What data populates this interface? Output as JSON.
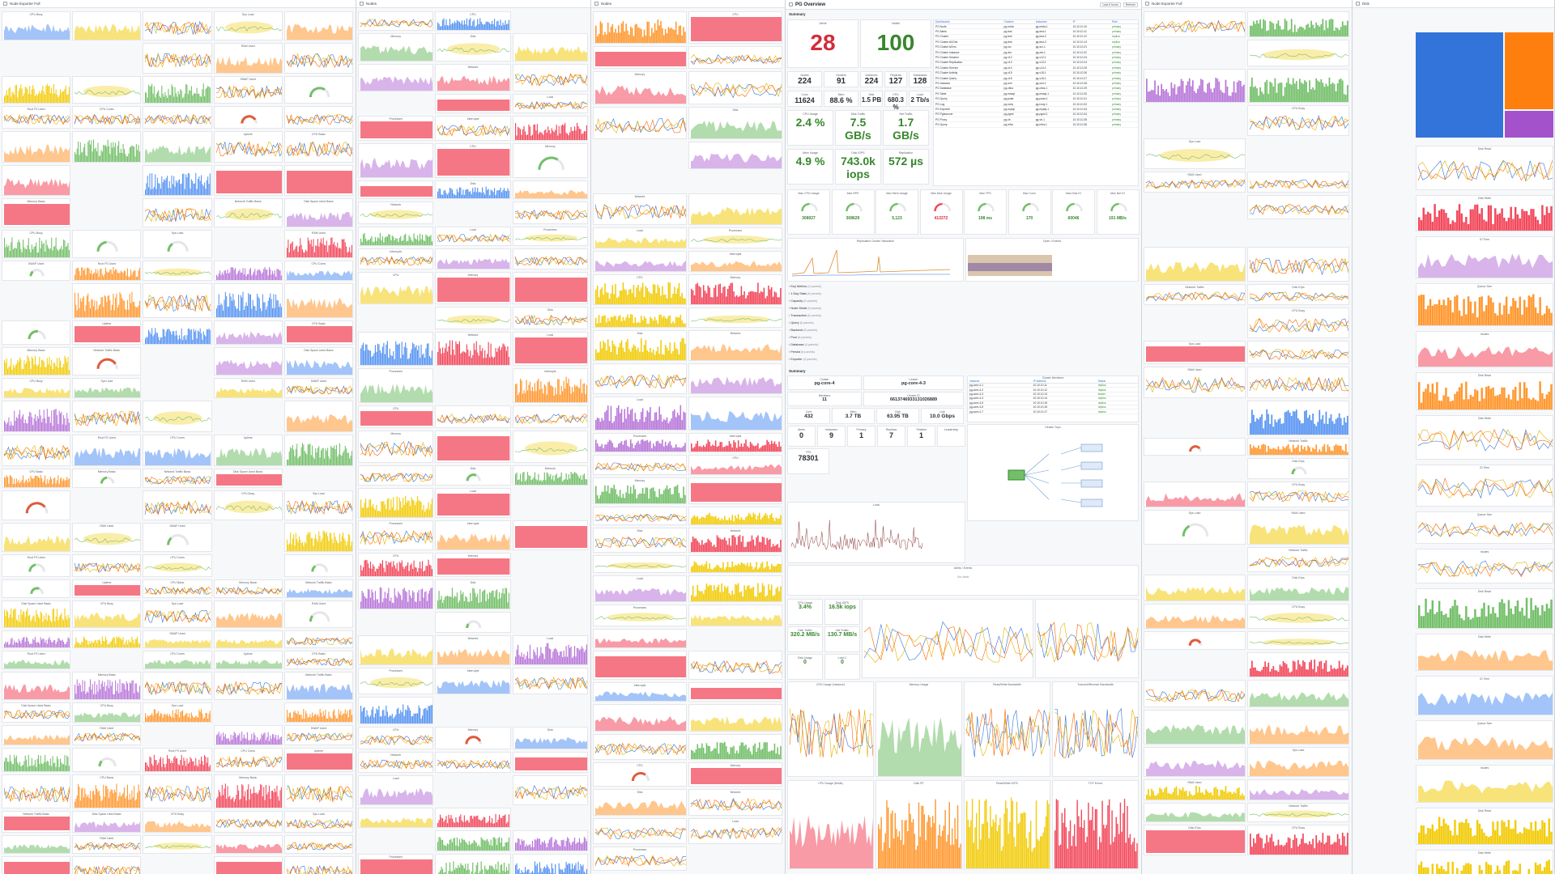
{
  "windows": [
    {
      "id": "w1",
      "title": "Node Exporter Full"
    },
    {
      "id": "w2",
      "title": "Nodes"
    },
    {
      "id": "w3",
      "title": "PG Overview"
    },
    {
      "id": "w4",
      "title": "Node Exporter Full"
    },
    {
      "id": "w5",
      "title": "Disk"
    }
  ],
  "pg": {
    "title": "PG Overview",
    "toolbar": [
      "Last 6 hours",
      "Refresh"
    ],
    "summary_label": "Summary",
    "stats_big": [
      {
        "label": "Alerts",
        "value": "28",
        "tone": "red"
      },
      {
        "label": "Health",
        "value": "100",
        "tone": "grn"
      }
    ],
    "stats_row1": [
      {
        "label": "Nodes",
        "value": "224"
      },
      {
        "label": "Clusters",
        "value": "91"
      },
      {
        "label": "Instances",
        "value": "224"
      },
      {
        "label": "Replicas",
        "value": "127"
      },
      {
        "label": "Databases",
        "value": "128"
      }
    ],
    "stats_row2": [
      {
        "label": "Conn",
        "value": "11624"
      },
      {
        "label": "Mem",
        "value": "88.6 %"
      },
      {
        "label": "Disk",
        "value": "1.5 PB"
      },
      {
        "label": "CPU",
        "value": "680.3 %"
      },
      {
        "label": "Load",
        "value": "2 Tb/s"
      }
    ],
    "stats_row3": [
      {
        "label": "CPU Usage",
        "value": "2.4 %"
      },
      {
        "label": "Disk Traffic",
        "value": "7.5 GB/s"
      },
      {
        "label": "Net Traffic",
        "value": "1.7 GB/s"
      }
    ],
    "stats_row4": [
      {
        "label": "Mem Usage",
        "value": "4.9 %"
      },
      {
        "label": "Disk IOPS",
        "value": "743.0k iops"
      },
      {
        "label": "Replication",
        "value": "572 µs"
      }
    ],
    "dash_table": {
      "headers": [
        "Dashboards",
        "Clusters",
        "Instances",
        "IP",
        "Role"
      ],
      "rows": [
        [
          "PG Node",
          "pg-meta",
          "pg-meta-1",
          "10.10.10.10",
          "primary"
        ],
        [
          "PG Alerts",
          "pg-test",
          "pg-test-1",
          "10.10.10.11",
          "primary"
        ],
        [
          "PG Cluster",
          "pg-test",
          "pg-test-2",
          "10.10.10.12",
          "replica"
        ],
        [
          "PG Cluster All Dbs",
          "pg-test",
          "pg-test-3",
          "10.10.10.13",
          "replica"
        ],
        [
          "PG Cluster All Ins",
          "pg-src",
          "pg-src-1",
          "10.10.10.21",
          "primary"
        ],
        [
          "PG Cluster Instance",
          "pg-dst",
          "pg-dst-1",
          "10.10.10.22",
          "primary"
        ],
        [
          "PG Cluster Session",
          "pg-v12",
          "pg-v12-1",
          "10.10.10.23",
          "primary"
        ],
        [
          "PG Cluster Replication",
          "pg-v13",
          "pg-v13-1",
          "10.10.10.24",
          "primary"
        ],
        [
          "PG Cluster Service",
          "pg-v14",
          "pg-v14-1",
          "10.10.10.25",
          "primary"
        ],
        [
          "PG Cluster Activity",
          "pg-v15",
          "pg-v15-1",
          "10.10.10.26",
          "primary"
        ],
        [
          "PG Cluster Query",
          "pg-v16",
          "pg-v16-1",
          "10.10.10.27",
          "primary"
        ],
        [
          "PG Instance",
          "pg-orcl",
          "pg-orcl-1",
          "10.10.10.28",
          "primary"
        ],
        [
          "PG Database",
          "pg-citus",
          "pg-citus-1",
          "10.10.10.29",
          "primary"
        ],
        [
          "PG Table",
          "pg-mssql",
          "pg-mssql-1",
          "10.10.10.30",
          "primary"
        ],
        [
          "PG Query",
          "pg-polar",
          "pg-polar-1",
          "10.10.10.31",
          "primary"
        ],
        [
          "PG Log",
          "pg-ivory",
          "pg-ivory-1",
          "10.10.10.32",
          "primary"
        ],
        [
          "PG Exporter",
          "pg-mysql",
          "pg-mysql-1",
          "10.10.10.33",
          "primary"
        ],
        [
          "PG Pgbouncer",
          "pg-pgml",
          "pg-pgml-1",
          "10.10.10.34",
          "primary"
        ],
        [
          "PG Proxy",
          "pg-vb",
          "pg-vb-1",
          "10.10.10.35",
          "primary"
        ],
        [
          "PG Query",
          "pg-infra",
          "pg-infra-1",
          "10.10.10.36",
          "primary"
        ]
      ]
    },
    "mid_row_labels": [
      "Max CPU Usage",
      "Max RPS",
      "Max Mem Usage",
      "Max Disk Usage",
      "Max TPS",
      "Max Conn",
      "Max Disk IO",
      "Max Net IO"
    ],
    "mid_row_values": [
      "308027",
      "308629",
      "5,123",
      "412272",
      "198 ms",
      "170",
      "60046",
      "191 MB/s"
    ],
    "replication_title": "Replication Cluster Saturation",
    "open_events_title": "Open / Events",
    "collapsed": [
      {
        "label": "Key Metrics",
        "n": "(4 panels)"
      },
      {
        "label": "1 Day Stats",
        "n": "(6 panels)"
      },
      {
        "label": "Capacity",
        "n": "(6 panels)"
      },
      {
        "label": "Node Detail",
        "n": "(8 panels)"
      },
      {
        "label": "Transaction",
        "n": "(8 panels)"
      },
      {
        "label": "Query",
        "n": "(6 panels)"
      },
      {
        "label": "Backend",
        "n": "(8 panels)"
      },
      {
        "label": "Pool",
        "n": "(6 panels)"
      },
      {
        "label": "Database",
        "n": "(4 panels)"
      },
      {
        "label": "Persist",
        "n": "(6 panels)"
      },
      {
        "label": "Exporter",
        "n": "(4 panels)"
      }
    ],
    "summary2": "Summary",
    "cluster_stats": [
      {
        "label": "Cluster",
        "value": "pg-core-4"
      },
      {
        "label": "Leader",
        "value": "pg-core-4-3"
      },
      {
        "label": "Members",
        "value": "11"
      },
      {
        "label": "Cluster ID",
        "value": "6613746933131026889"
      }
    ],
    "cap_stats": [
      {
        "label": "Core",
        "value": "432"
      },
      {
        "label": "Mem",
        "value": "3.7 TB"
      },
      {
        "label": "Disk",
        "value": "63.95 TB"
      },
      {
        "label": "Link",
        "value": "10.0 Gbps"
      }
    ],
    "role_stats": [
      {
        "label": "Alerts",
        "value": "0"
      },
      {
        "label": "Instances",
        "value": "9"
      },
      {
        "label": "Primary",
        "value": "1"
      },
      {
        "label": "Replicas",
        "value": "7"
      },
      {
        "label": "Timeline",
        "value": "1"
      },
      {
        "label": "Leadership",
        "value": ""
      }
    ],
    "members_title": "Cluster Members",
    "members_headers": [
      "Instance",
      "IP Address",
      "Status"
    ],
    "members": [
      [
        "pg-core-4-1",
        "10.10.10.11",
        "replica"
      ],
      [
        "pg-core-4-2",
        "10.10.10.12",
        "replica"
      ],
      [
        "pg-core-4-3",
        "10.10.10.13",
        "leader"
      ],
      [
        "pg-core-4-4",
        "10.10.10.14",
        "replica"
      ],
      [
        "pg-core-4-5",
        "10.10.10.15",
        "replica"
      ],
      [
        "pg-core-4-6",
        "10.10.10.16",
        "replica"
      ],
      [
        "pg-core-4-7",
        "10.10.10.17",
        "replica"
      ]
    ],
    "topology_title": "Cluster Topo",
    "tps_value": "78301",
    "load_title": "Load",
    "alerts_events_title": "Alerts / Events",
    "no_data": "No data",
    "io_labels": [
      "CPU Usage",
      "Disk IOPS",
      "Disk Traffic",
      "Net Traffic",
      "Disk Usage",
      "Load 1"
    ],
    "io_values": [
      "3.4%",
      "16.5k iops",
      "320.2 MB/s",
      "130.7 MB/s",
      "0",
      "0"
    ],
    "node_table_title": "Node Stats",
    "bottom_titles": [
      "CPU Usage (Instance)",
      "Memory Usage",
      "Read/Write Bandwidth",
      "Transmit/Receive Bandwidth"
    ],
    "bottom_titles2": [
      "CPU Usage (Mode)",
      "Disk RT",
      "Read/Write IOPS",
      "TCP Errors"
    ]
  },
  "panel_titles": {
    "w1": [
      "CPU Busy",
      "Sys Load",
      "RAM Used",
      "SWAP Used",
      "Root FS Used",
      "CPU Cores",
      "Uptime",
      "CPU Basic",
      "Memory Basic",
      "Network Traffic Basic",
      "Disk Space Used Basic"
    ],
    "w2": [
      "CPU",
      "Memory",
      "Disk",
      "Network",
      "Load",
      "Processes",
      "Interrupts"
    ],
    "w4": [
      "CPU Busy",
      "Sys Load",
      "RAM Used",
      "Network Traffic",
      "Disk IOps"
    ],
    "w5": [
      "Disk Read",
      "Disk Write",
      "IO Time",
      "Queue Size",
      "Inodes"
    ]
  },
  "colors": {
    "accent": "#37872d",
    "alert": "#d42b3a",
    "blue": "#3274d9",
    "orange": "#ff7f0e",
    "purple": "#8e44ad",
    "yellow": "#f2cc0c"
  }
}
